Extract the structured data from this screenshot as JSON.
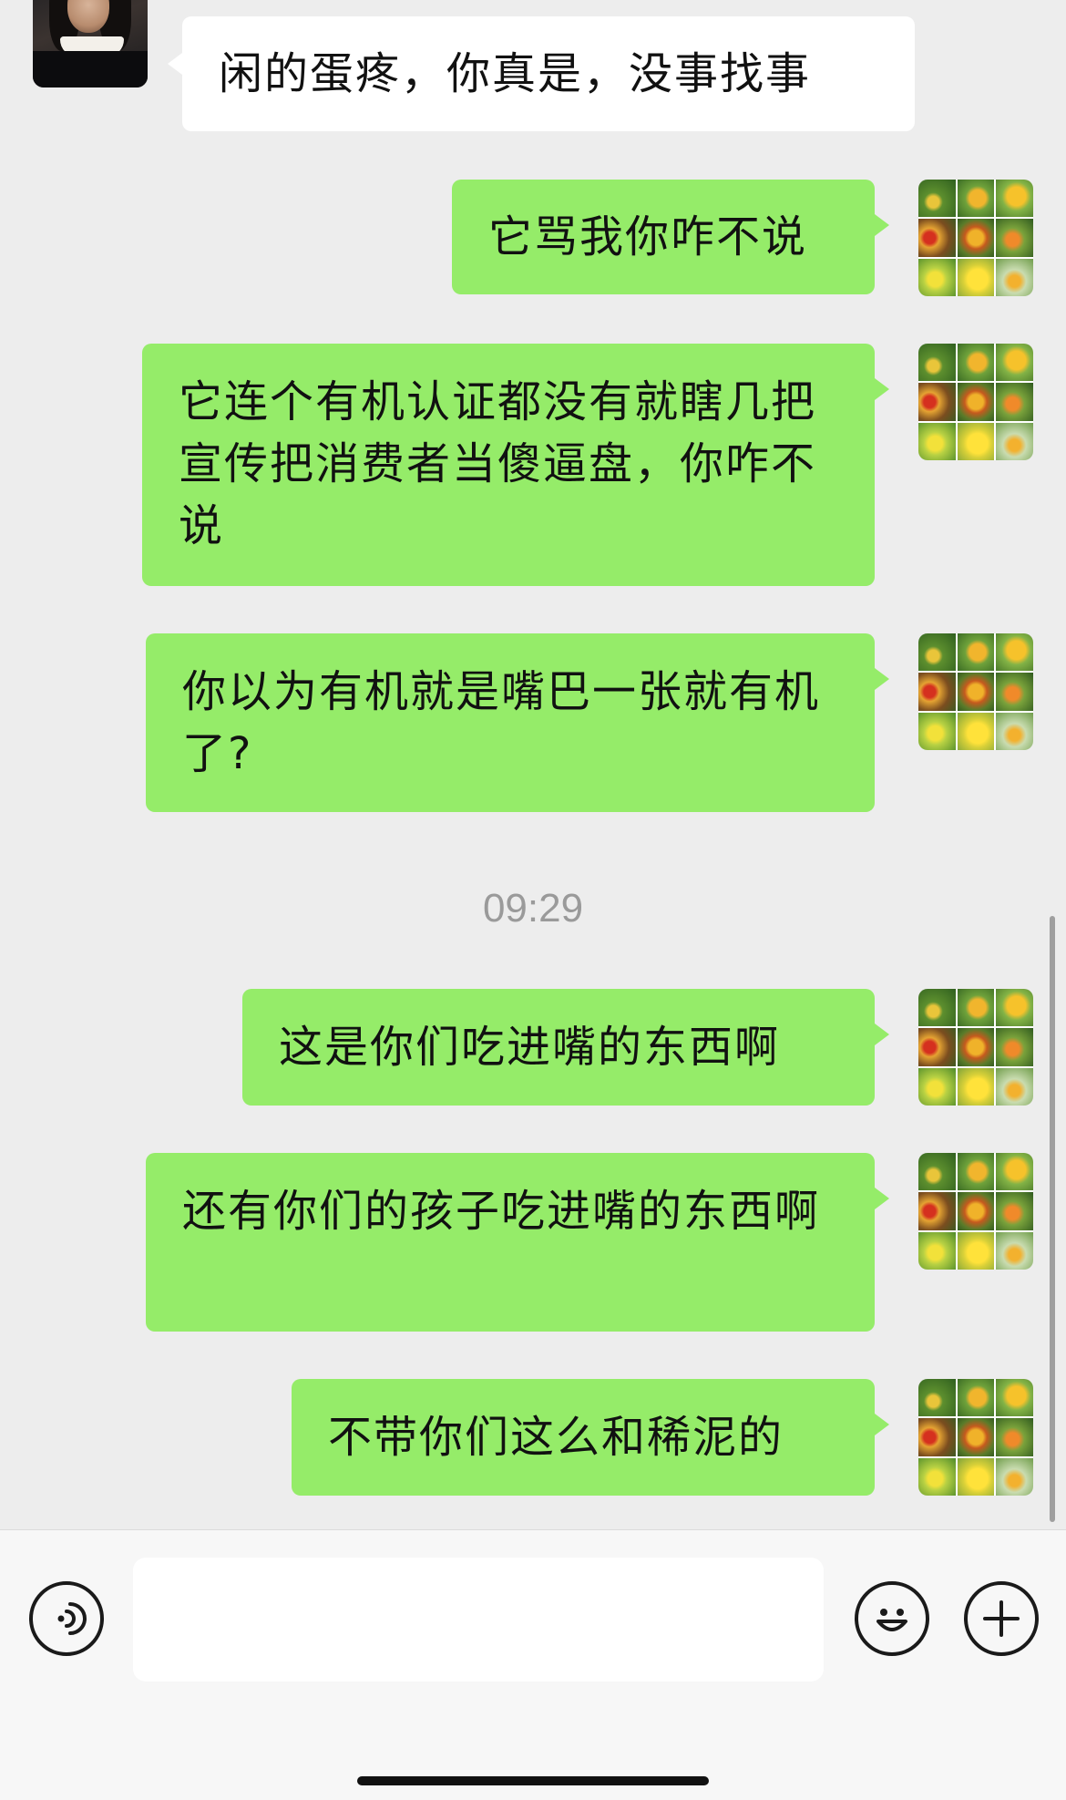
{
  "messages": [
    {
      "id": "m1",
      "side": "other",
      "text": "闲的蛋疼，你真是，没事找事"
    },
    {
      "id": "m2",
      "side": "me",
      "text": "它骂我你咋不说"
    },
    {
      "id": "m3",
      "side": "me",
      "text": "它连个有机认证都没有就瞎几把宣传把消费者当傻逼盘，你咋不说"
    },
    {
      "id": "m4",
      "side": "me",
      "text": "你以为有机就是嘴巴一张就有机了?"
    },
    {
      "id": "m5",
      "side": "me",
      "text": "这是你们吃进嘴的东西啊"
    },
    {
      "id": "m6",
      "side": "me",
      "text": "还有你们的孩子吃进嘴的东西啊"
    },
    {
      "id": "m7",
      "side": "me",
      "text": "不带你们这么和稀泥的"
    }
  ],
  "timestamp": "09:29",
  "input": {
    "value": "",
    "placeholder": ""
  },
  "colors": {
    "my_bubble": "#95ec69",
    "other_bubble": "#ffffff",
    "background": "#ededed"
  },
  "icons": {
    "voice": "voice-icon",
    "emoji": "emoji-icon",
    "more": "plus-icon"
  }
}
